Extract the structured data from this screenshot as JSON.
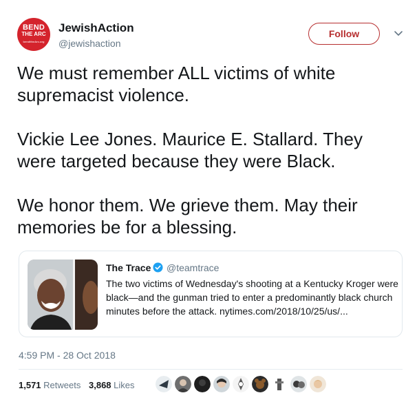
{
  "author": {
    "avatar_text": [
      "BEND",
      "THE ARC",
      "benditheArc.org"
    ],
    "name": "JewishAction",
    "handle": "@jewishaction"
  },
  "follow_label": "Follow",
  "tweet_text": "We must remember ALL victims of white supremacist violence.\n\nVickie Lee Jones. Maurice E. Stallard. They were targeted because they were Black.\n\nWe honor them. We grieve them. May their memories be for a blessing.",
  "quoted_tweet": {
    "name": "The Trace",
    "handle": "@teamtrace",
    "text": "The two victims of Wednesday's shooting at a Kentucky Kroger were black—and the gunman tried to enter a predominantly black church minutes before the attack. nytimes.com/2018/10/25/us/..."
  },
  "timestamp": "4:59 PM - 28 Oct 2018",
  "stats": {
    "retweets_count": "1,571",
    "retweets_label": "Retweets",
    "likes_count": "3,868",
    "likes_label": "Likes"
  },
  "colors": {
    "accent": "#b62d2e",
    "verified": "#1da1f2",
    "secondary_text": "#657786"
  }
}
